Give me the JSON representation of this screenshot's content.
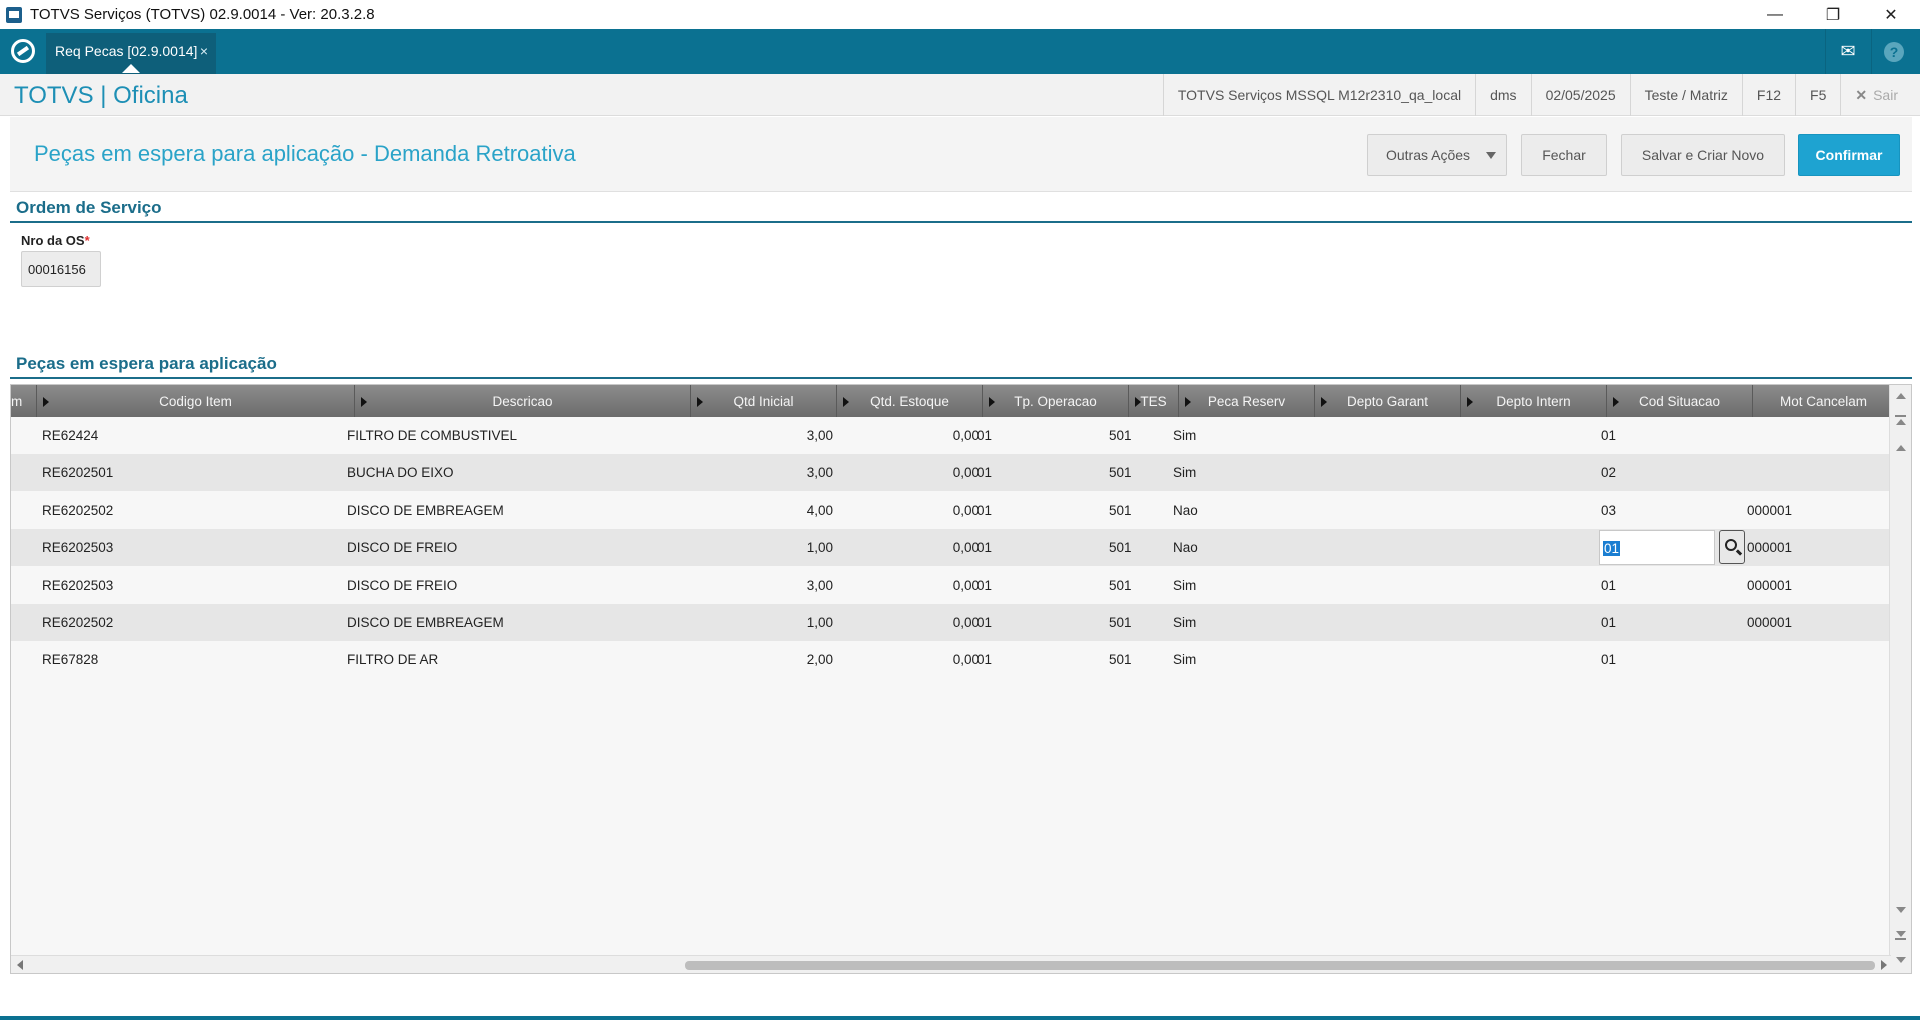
{
  "window": {
    "title": "TOTVS Serviços (TOTVS) 02.9.0014 - Ver: 20.3.2.8",
    "minimize": "—",
    "restore": "❐",
    "close": "✕"
  },
  "tabbar": {
    "tab_label": "Req Pecas [02.9.0014]",
    "tab_close": "×",
    "mail_icon": "✉",
    "help_icon": "?"
  },
  "header": {
    "brand": "TOTVS | Oficina",
    "environment": "TOTVS Serviços MSSQL M12r2310_qa_local",
    "module": "dms",
    "date": "02/05/2025",
    "branch": "Teste / Matriz",
    "f12": "F12",
    "f5": "F5",
    "sair": "Sair"
  },
  "page": {
    "title": "Peças em espera para aplicação - Demanda Retroativa",
    "buttons": {
      "outras_acoes": "Outras Ações",
      "fechar": "Fechar",
      "salvar_criar": "Salvar e Criar Novo",
      "confirmar": "Confirmar"
    }
  },
  "ordem": {
    "section_title": "Ordem de Serviço",
    "field_label": "Nro da OS",
    "required_mark": "*",
    "field_value": "00016156"
  },
  "pecas": {
    "section_title": "Peças em espera para aplicação",
    "columns": [
      "m",
      "Codigo Item",
      "Descricao",
      "Qtd Inicial",
      "Qtd. Estoque",
      "Tp. Operacao",
      "TES",
      "Peca Reserv",
      "Depto Garant",
      "Depto Intern",
      "Cod Situacao",
      "Mot Cancelam"
    ],
    "rows": [
      {
        "codigo": "RE62424",
        "descricao": "FILTRO DE COMBUSTIVEL",
        "qtd_inicial": "3,00",
        "qtd_estoque": "0,00",
        "tp_operacao": "01",
        "tes": "501",
        "peca_reserv": "Sim",
        "cod_situacao": "01",
        "mot_cancelam": ""
      },
      {
        "codigo": "RE6202501",
        "descricao": "BUCHA DO EIXO",
        "qtd_inicial": "3,00",
        "qtd_estoque": "0,00",
        "tp_operacao": "01",
        "tes": "501",
        "peca_reserv": "Sim",
        "cod_situacao": "02",
        "mot_cancelam": ""
      },
      {
        "codigo": "RE6202502",
        "descricao": "DISCO DE EMBREAGEM",
        "qtd_inicial": "4,00",
        "qtd_estoque": "0,00",
        "tp_operacao": "01",
        "tes": "501",
        "peca_reserv": "Nao",
        "cod_situacao": "03",
        "mot_cancelam": "000001"
      },
      {
        "codigo": "RE6202503",
        "descricao": "DISCO DE FREIO",
        "qtd_inicial": "1,00",
        "qtd_estoque": "0,00",
        "tp_operacao": "01",
        "tes": "501",
        "peca_reserv": "Nao",
        "cod_situacao": "01",
        "mot_cancelam": "000001"
      },
      {
        "codigo": "RE6202503",
        "descricao": "DISCO DE FREIO",
        "qtd_inicial": "3,00",
        "qtd_estoque": "0,00",
        "tp_operacao": "01",
        "tes": "501",
        "peca_reserv": "Sim",
        "cod_situacao": "01",
        "mot_cancelam": "000001"
      },
      {
        "codigo": "RE6202502",
        "descricao": "DISCO DE EMBREAGEM",
        "qtd_inicial": "1,00",
        "qtd_estoque": "0,00",
        "tp_operacao": "01",
        "tes": "501",
        "peca_reserv": "Sim",
        "cod_situacao": "01",
        "mot_cancelam": "000001"
      },
      {
        "codigo": "RE67828",
        "descricao": "FILTRO DE AR",
        "qtd_inicial": "2,00",
        "qtd_estoque": "0,00",
        "tp_operacao": "01",
        "tes": "501",
        "peca_reserv": "Sim",
        "cod_situacao": "01",
        "mot_cancelam": ""
      }
    ],
    "editing_row": 3
  },
  "colors": {
    "teal_bar": "#0b7191",
    "brand_blue": "#1d8fb5",
    "primary_button": "#1ea3d1",
    "section_title": "#1b6d8a"
  }
}
